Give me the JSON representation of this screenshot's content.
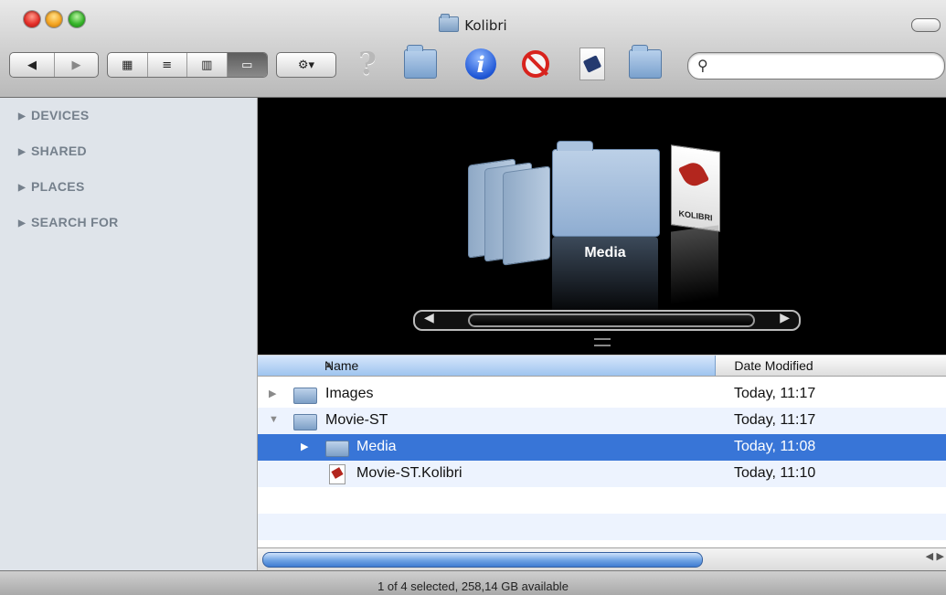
{
  "window": {
    "title": "Kolibri"
  },
  "toolbar": {
    "back_icon": "◀",
    "forward_icon": "▶",
    "view_icons": [
      "▦",
      "≡",
      "▥",
      "▭"
    ],
    "action_icon": "⚙▾",
    "help_icon": "?",
    "info_icon": "i",
    "search": {
      "placeholder": "",
      "value": ""
    }
  },
  "sidebar": {
    "groups": [
      "DEVICES",
      "SHARED",
      "PLACES",
      "SEARCH FOR"
    ]
  },
  "coverflow": {
    "selected_label": "Media",
    "doc_label": "KOLIBRI"
  },
  "list": {
    "columns": {
      "name": "Name",
      "date": "Date Modified"
    },
    "rows": [
      {
        "name": "Images",
        "date": "Today, 11:17"
      },
      {
        "name": "Movie-ST",
        "date": "Today, 11:17"
      },
      {
        "name": "Media",
        "date": "Today, 11:08"
      },
      {
        "name": "Movie-ST.Kolibri",
        "date": "Today, 11:10"
      }
    ]
  },
  "status": {
    "text": "1 of 4 selected, 258,14 GB available"
  },
  "colors": {
    "selection": "#3875d7",
    "alt_row": "#edf3fe",
    "sidebar": "#dfe4ea"
  }
}
